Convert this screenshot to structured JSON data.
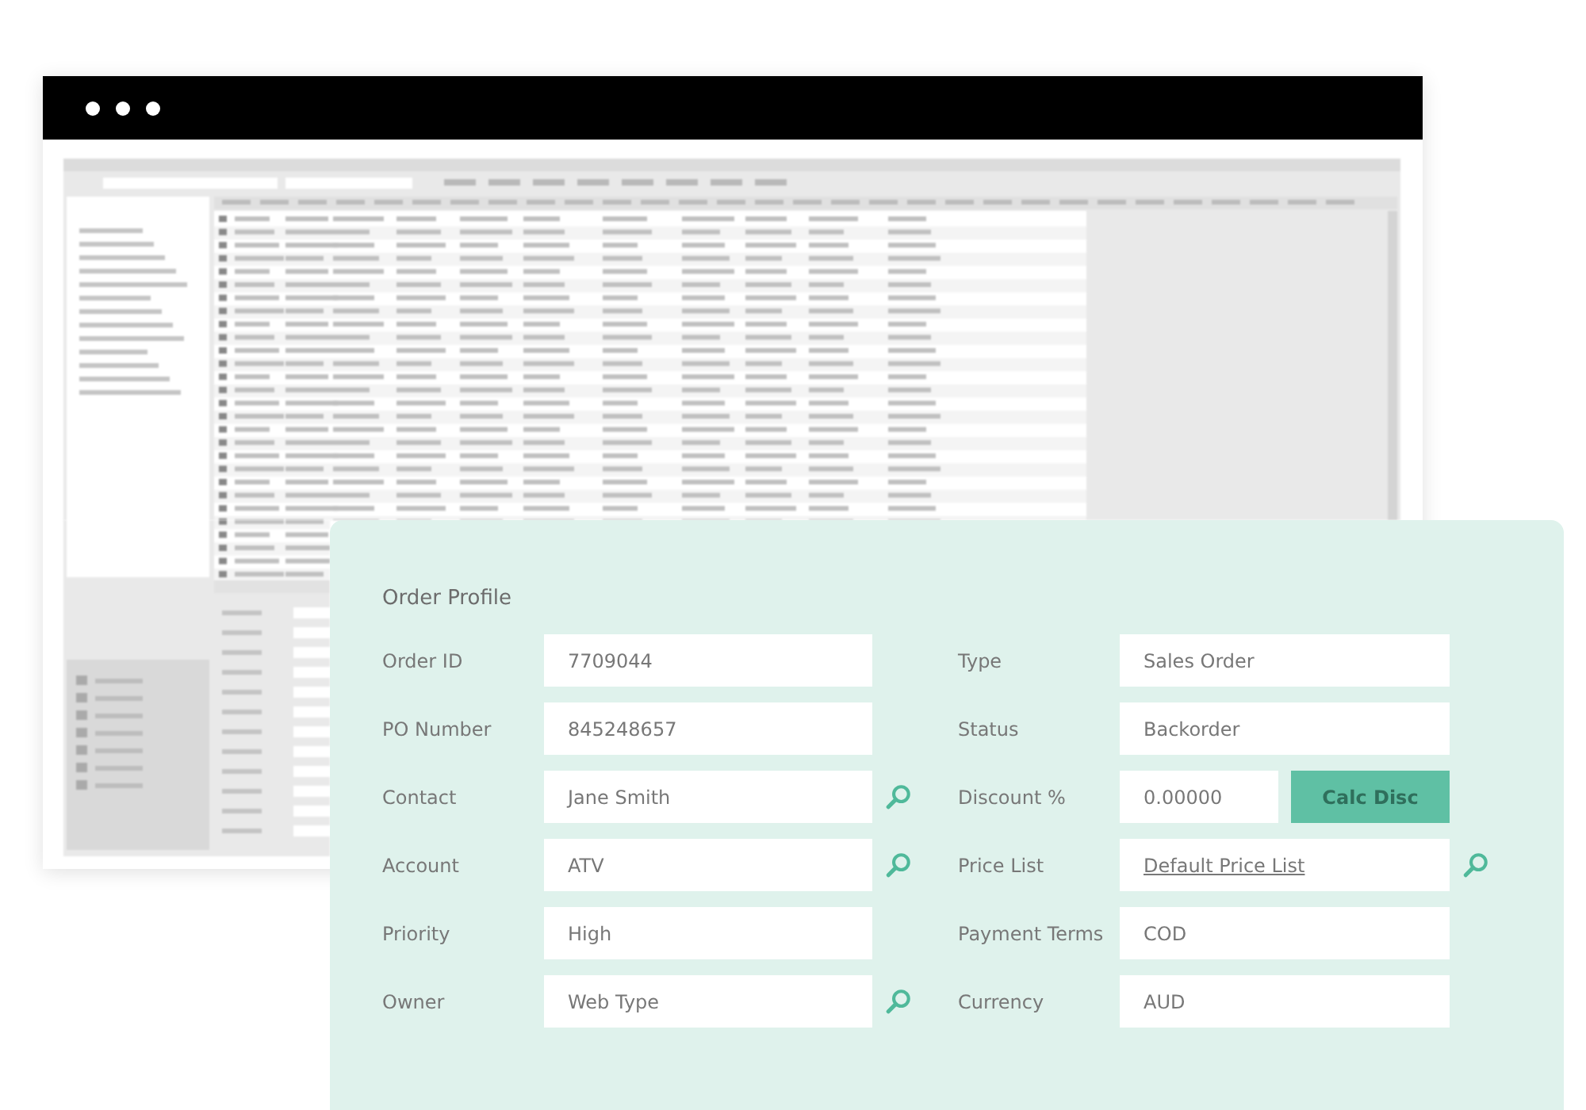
{
  "card": {
    "title": "Order Profile",
    "left_fields": [
      {
        "label": "Order ID",
        "value": "7709044",
        "lookup": false
      },
      {
        "label": "PO Number",
        "value": "845248657",
        "lookup": false
      },
      {
        "label": "Contact",
        "value": "Jane Smith",
        "lookup": true
      },
      {
        "label": "Account",
        "value": "ATV",
        "lookup": true
      },
      {
        "label": "Priority",
        "value": "High",
        "lookup": false
      },
      {
        "label": "Owner",
        "value": "Web Type",
        "lookup": true
      }
    ],
    "right_fields": [
      {
        "kind": "text",
        "label": "Type",
        "value": "Sales Order",
        "lookup": false
      },
      {
        "kind": "text",
        "label": "Status",
        "value": "Backorder",
        "lookup": false
      },
      {
        "kind": "action",
        "label": "Discount %",
        "value": "0.00000",
        "button": "Calc Disc",
        "lookup": false
      },
      {
        "kind": "link",
        "label": "Price List",
        "value": "Default Price List",
        "lookup": true
      },
      {
        "kind": "text",
        "label": "Payment Terms",
        "value": "COD",
        "lookup": false
      },
      {
        "kind": "text",
        "label": "Currency",
        "value": "AUD",
        "lookup": false
      }
    ]
  }
}
